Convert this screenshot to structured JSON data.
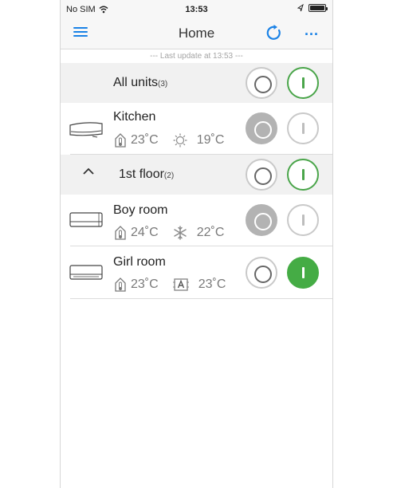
{
  "status_bar": {
    "carrier": "No SIM",
    "time": "13:53"
  },
  "nav": {
    "title": "Home",
    "more_label": "..."
  },
  "last_update": "--- Last update at 13:53 ---",
  "all_units": {
    "label": "All units",
    "count": "(3)"
  },
  "floor": {
    "label": "1st floor",
    "count": "(2)"
  },
  "units": [
    {
      "name": "Kitchen",
      "room_temp": "23˚C",
      "mode_icon": "sun-icon",
      "set_temp": "19˚C",
      "power": "off"
    },
    {
      "name": "Boy room",
      "room_temp": "24˚C",
      "mode_icon": "snowflake-icon",
      "set_temp": "22˚C",
      "power": "off"
    },
    {
      "name": "Girl room",
      "room_temp": "23˚C",
      "mode_icon": "auto-mode-icon",
      "set_temp": "23˚C",
      "power": "on"
    }
  ],
  "colors": {
    "accent": "#1a82e6",
    "on_green": "#45ac45",
    "off_gray": "#b3b3b3"
  }
}
